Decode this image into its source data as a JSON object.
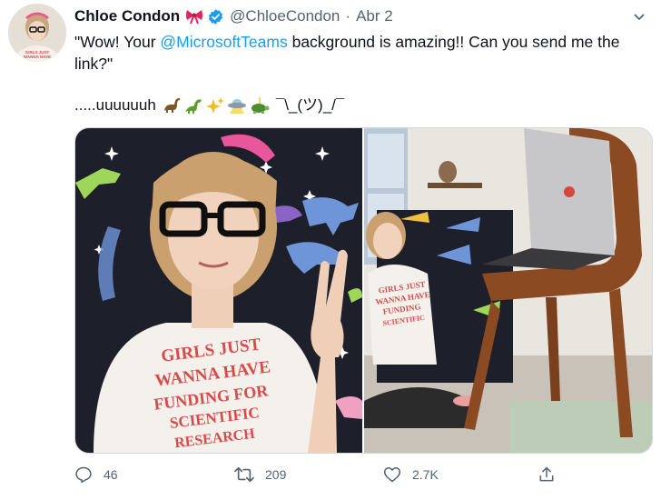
{
  "tweet": {
    "author": {
      "name": "Chloe Condon",
      "handle": "@ChloeCondon",
      "verified": true,
      "name_emoji": "bow-icon"
    },
    "separator": "·",
    "date": "Abr 2",
    "text_parts": {
      "before": "\"Wow! Your ",
      "mention": "@MicrosoftTeams",
      "after": " background is amazing!! Can you send me the link?\""
    },
    "second_line": {
      "text": ".....uuuuuuh",
      "emojis": [
        "sauropod-icon",
        "dinosaur-icon",
        "sparkles-icon",
        "ufo-icon",
        "turtle-icon"
      ],
      "shrug": "¯\\_(ツ)_/¯"
    },
    "media": {
      "left_alt": "shirt-text",
      "left_shirt_text": [
        "GIRLS JUST",
        "WANNA HAVE",
        "FUNDING FOR",
        "SCIENTIFIC",
        "RESEARCH"
      ],
      "right_shirt_text": [
        "GIRLS JUST",
        "WANNA HAVE",
        "FUNDING",
        "SCIENTIFIC"
      ]
    },
    "actions": {
      "reply_count": "46",
      "retweet_count": "209",
      "like_count": "2.7K"
    }
  },
  "colors": {
    "accent": "#1d9bf0",
    "muted": "#536471",
    "shirt_text": "#d94a4a"
  }
}
